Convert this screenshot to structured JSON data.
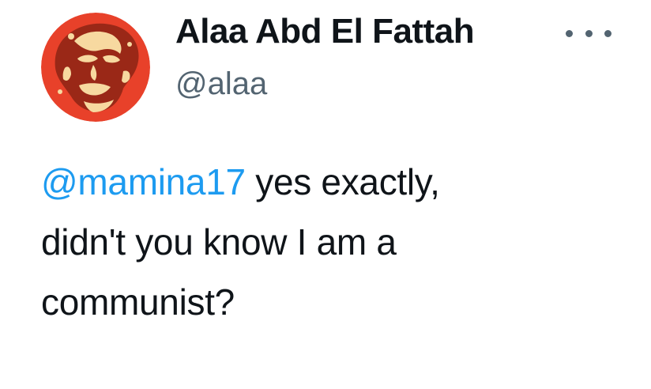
{
  "tweet": {
    "author": {
      "display_name": "Alaa Abd El Fattah",
      "handle": "@alaa",
      "avatar_icon": "profile-portrait-icon",
      "avatar_colors": {
        "background": "#e8412a",
        "highlight": "#f7d9a0",
        "shadow": "#5a1408"
      }
    },
    "more_icon": "ellipsis-icon",
    "text": {
      "mention": "@mamina17",
      "line1_rest": " yes exactly,",
      "line2": "didn't you know I am a",
      "line3": "communist?"
    },
    "colors": {
      "text": "#0f1419",
      "secondary": "#536471",
      "link": "#1d9bf0"
    }
  }
}
